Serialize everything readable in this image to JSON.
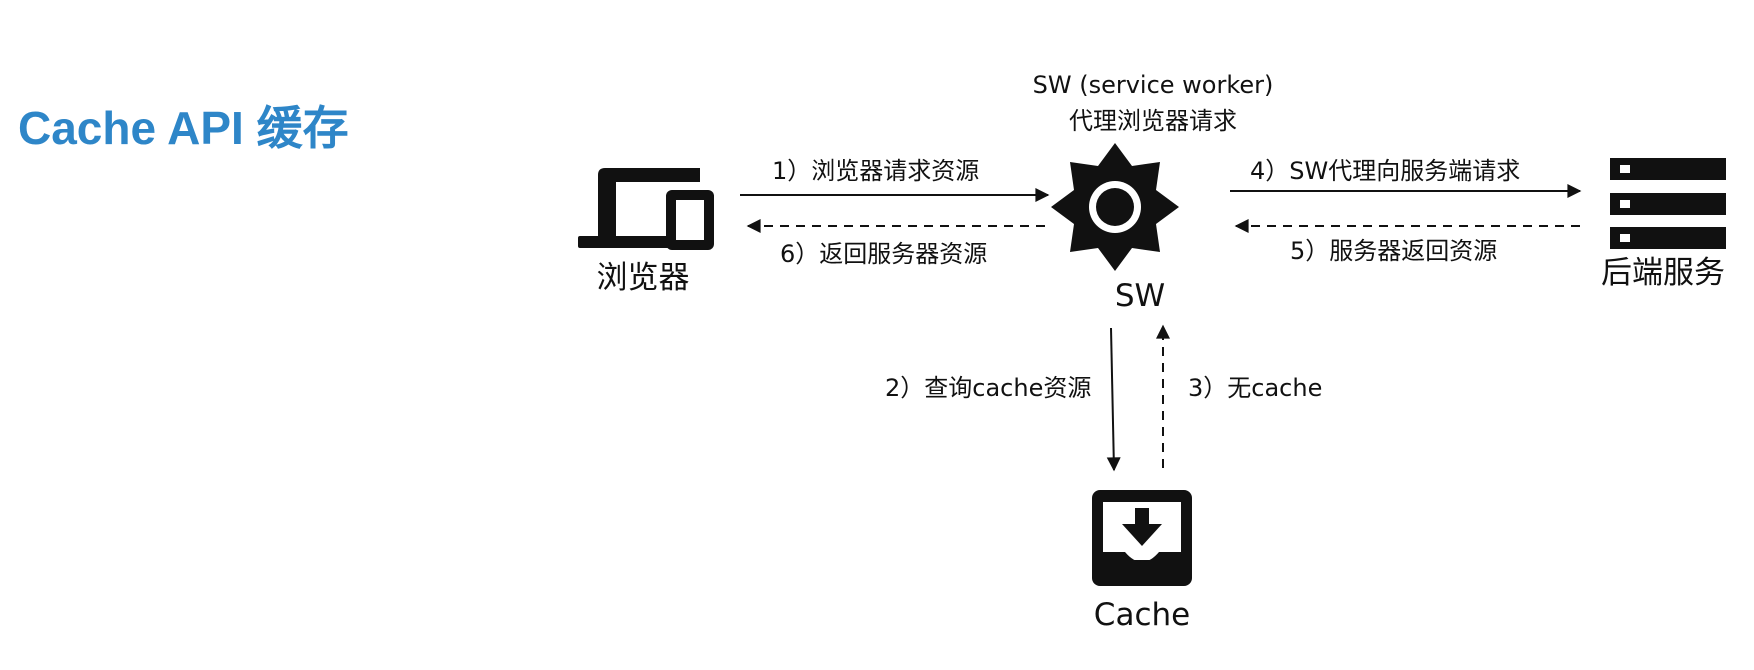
{
  "title": "Cache API 缓存",
  "nodes": {
    "browser": {
      "label": "浏览器",
      "icon": "laptop-phone-icon"
    },
    "sw": {
      "label": "SW",
      "caption_line1": "SW (service worker)",
      "caption_line2": "代理浏览器请求",
      "icon": "gear-icon"
    },
    "backend": {
      "label": "后端服务",
      "icon": "server-icon"
    },
    "cache": {
      "label": "Cache",
      "icon": "download-tray-icon"
    }
  },
  "edges": {
    "step1": {
      "label": "1）浏览器请求资源",
      "from": "browser",
      "to": "sw",
      "style": "solid"
    },
    "step2": {
      "label": "2）查询cache资源",
      "from": "sw",
      "to": "cache",
      "style": "solid"
    },
    "step3": {
      "label": "3）无cache",
      "from": "cache",
      "to": "sw",
      "style": "dashed"
    },
    "step4": {
      "label": "4）SW代理向服务端请求",
      "from": "sw",
      "to": "backend",
      "style": "solid"
    },
    "step5": {
      "label": "5）服务器返回资源",
      "from": "backend",
      "to": "sw",
      "style": "dashed"
    },
    "step6": {
      "label": "6）返回服务器资源",
      "from": "sw",
      "to": "browser",
      "style": "dashed"
    }
  },
  "colors": {
    "title": "#2e86c8",
    "ink": "#111111"
  }
}
